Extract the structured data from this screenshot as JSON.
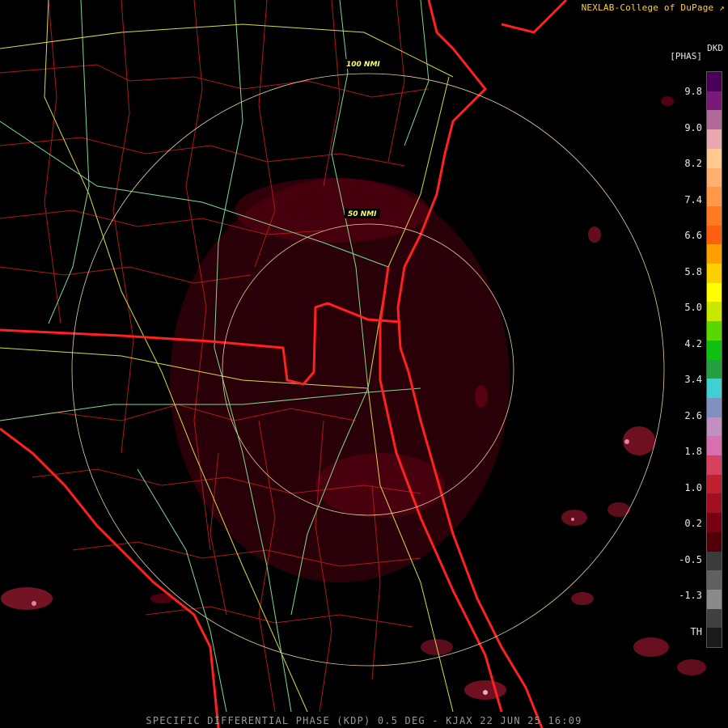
{
  "header": {
    "credit": "NEXLAB-College of DuPage",
    "credit_icon": "arrow-out-icon",
    "product_code": "DKD",
    "units": "[PHAS]"
  },
  "range_rings": [
    {
      "label": "50 NMI"
    },
    {
      "label": "100 NMI"
    }
  ],
  "colorbar": {
    "ticks": [
      "9.8",
      "9.0",
      "8.2",
      "7.4",
      "6.6",
      "5.8",
      "5.0",
      "4.2",
      "3.4",
      "2.6",
      "1.8",
      "1.0",
      "0.2",
      "-0.5",
      "-1.3",
      "TH"
    ],
    "colors": [
      "#4a0058",
      "#7a1a78",
      "#b06a9a",
      "#e8a8b0",
      "#ffc890",
      "#ffb070",
      "#ff9848",
      "#ff7a20",
      "#ff6010",
      "#ffa000",
      "#ffd000",
      "#ffff00",
      "#c8e800",
      "#58d800",
      "#10c010",
      "#24a040",
      "#40d0d0",
      "#8090c0",
      "#c090c0",
      "#d870b0",
      "#d84060",
      "#c02030",
      "#a01020",
      "#780010",
      "#500008",
      "#3a3a3a",
      "#606060",
      "#8a8a8a",
      "#404040",
      "#1a1a1a"
    ]
  },
  "footer": {
    "caption": "SPECIFIC DIFFERENTIAL PHASE (KDP) 0.5 DEG - KJAX 22 JUN 25 16:09"
  }
}
